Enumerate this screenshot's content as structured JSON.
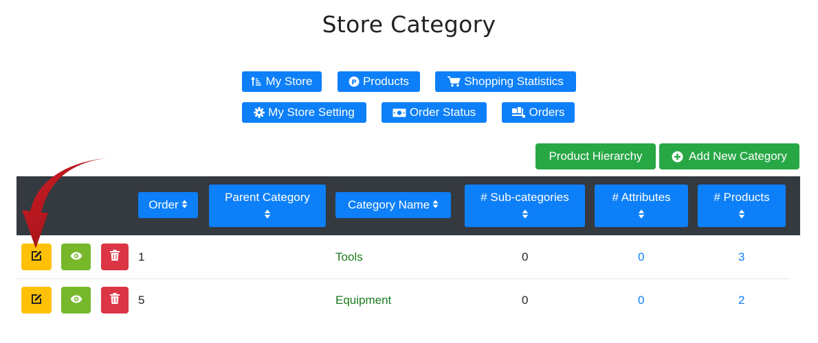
{
  "page": {
    "title": "Store Category"
  },
  "nav": {
    "my_store": {
      "label": "My Store",
      "icon": "sort-amount-icon"
    },
    "products": {
      "label": "Products",
      "icon": "product-circle-icon"
    },
    "shopping_statistics": {
      "label": "Shopping Statistics",
      "icon": "shopping-cart-icon"
    },
    "my_store_setting": {
      "label": "My Store Setting",
      "icon": "gear-icon"
    },
    "order_status": {
      "label": "Order Status",
      "icon": "money-bill-icon"
    },
    "orders": {
      "label": "Orders",
      "icon": "truck-loading-icon"
    }
  },
  "actions": {
    "product_hierarchy": "Product Hierarchy",
    "add_new_category": "Add New Category"
  },
  "table": {
    "headers": {
      "order": "Order",
      "parent_category": "Parent Category",
      "category_name": "Category Name",
      "sub_categories": "# Sub-categories",
      "attributes": "# Attributes",
      "products": "# Products"
    },
    "rows": [
      {
        "order": "1",
        "parent_category": "",
        "category_name": "Tools",
        "sub_categories": "0",
        "attributes": "0",
        "products": "3"
      },
      {
        "order": "5",
        "parent_category": "",
        "category_name": "Equipment",
        "sub_categories": "0",
        "attributes": "0",
        "products": "2"
      }
    ]
  },
  "colors": {
    "primary": "#0d7ff8",
    "success": "#28a745",
    "edit": "#ffc107",
    "view": "#76b82a",
    "delete": "#dc3545",
    "header_bar": "#343a40",
    "category_link": "#1b7a1b",
    "annotation_arrow": "#b5121b"
  }
}
